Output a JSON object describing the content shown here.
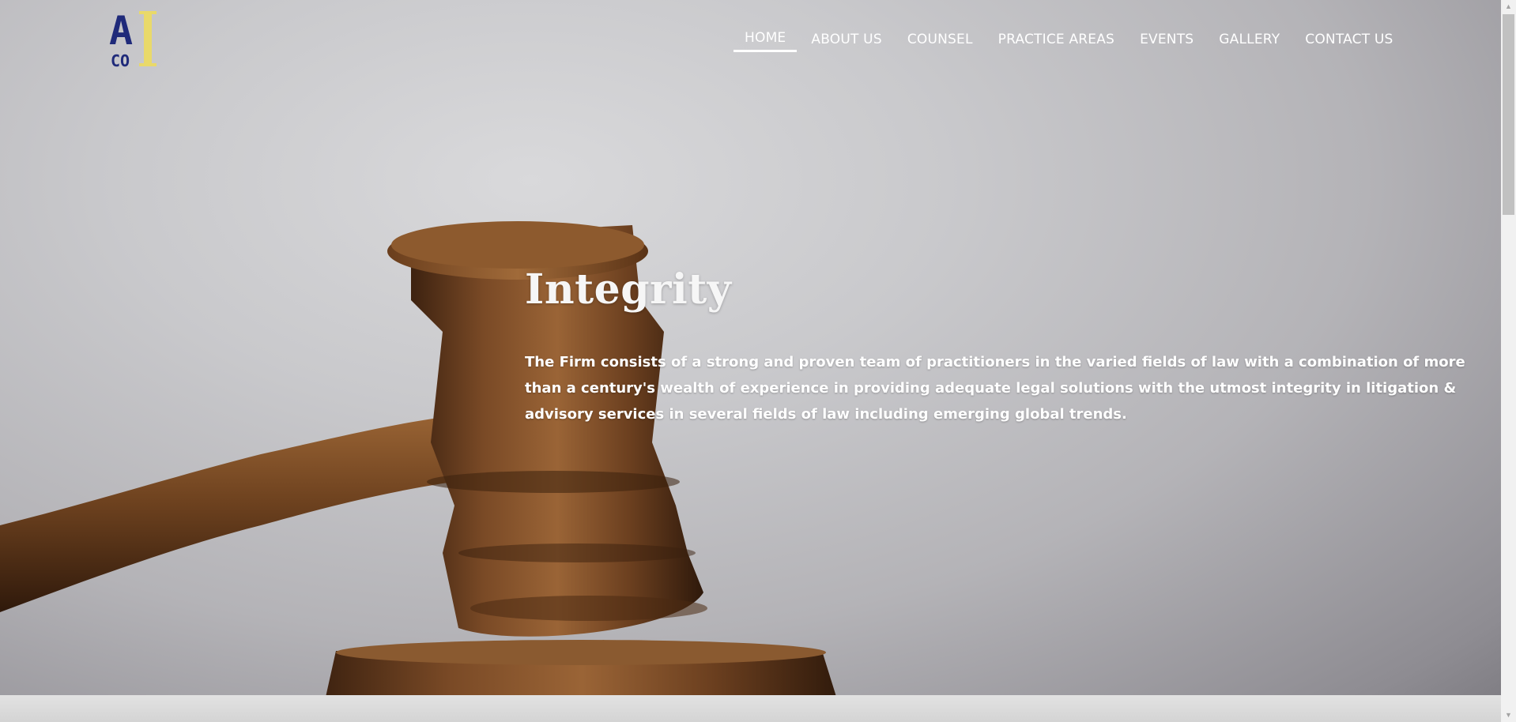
{
  "logo": {
    "letters_top": "A",
    "letters_bottom": "CO",
    "letter_bar": "I",
    "navy": "#1f2a7a",
    "gold": "#e9d96a"
  },
  "nav": {
    "items": [
      {
        "label": "HOME",
        "active": true
      },
      {
        "label": "ABOUT US"
      },
      {
        "label": "COUNSEL"
      },
      {
        "label": "PRACTICE AREAS"
      },
      {
        "label": "EVENTS"
      },
      {
        "label": "GALLERY"
      },
      {
        "label": "CONTACT US"
      }
    ]
  },
  "hero": {
    "title": "Integrity",
    "text": "The Firm consists of a strong and proven team of practitioners in the varied fields of law with a combination of more than a century's wealth of experience in providing adequate legal solutions with the utmost integrity in litigation & advisory services in several fields of law including emerging global trends."
  },
  "scrollbar": {
    "up_icon": "triangle-up",
    "down_icon": "triangle-down",
    "position_fraction": 0
  }
}
